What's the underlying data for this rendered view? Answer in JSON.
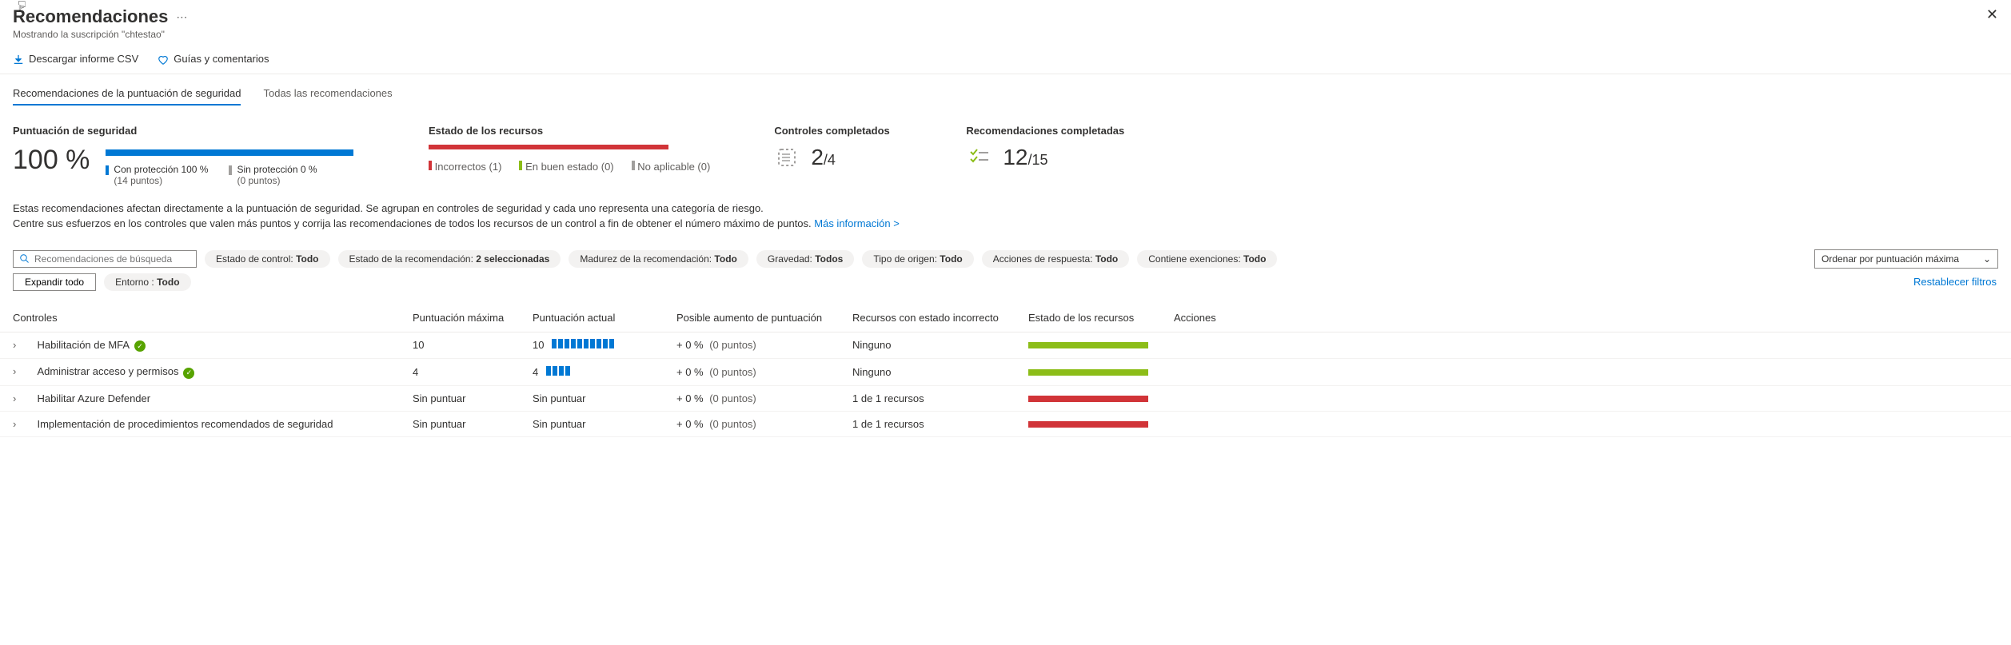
{
  "header": {
    "title": "Recomendaciones",
    "subtitle": "Mostrando la suscripción \"chtestao\""
  },
  "toolbar": {
    "download": "Descargar informe CSV",
    "guides": "Guías y comentarios"
  },
  "tabs": {
    "scored": "Recomendaciones de la puntuación de seguridad",
    "all": "Todas las recomendaciones"
  },
  "metrics": {
    "score": {
      "title": "Puntuación de seguridad",
      "value": "100 %",
      "protected_label": "Con protección 100 %",
      "protected_points": "(14 puntos)",
      "unprotected_label": "Sin protección 0 %",
      "unprotected_points": "(0 puntos)"
    },
    "resources": {
      "title": "Estado de los recursos",
      "bad": "Incorrectos (1)",
      "good": "En buen estado (0)",
      "na": "No aplicable (0)"
    },
    "controls": {
      "title": "Controles completados",
      "num": "2",
      "den": "/4"
    },
    "recs": {
      "title": "Recomendaciones completadas",
      "num": "12",
      "den": "/15"
    }
  },
  "description": {
    "line1": "Estas recomendaciones afectan directamente a la puntuación de seguridad. Se agrupan en controles de seguridad y cada uno representa una categoría de riesgo.",
    "line2": "Centre sus esfuerzos en los controles que valen más puntos y corrija las recomendaciones de todos los recursos de un control a fin de obtener el número máximo de puntos. ",
    "link": "Más información >"
  },
  "filters": {
    "search_placeholder": "Recomendaciones de búsqueda",
    "pills": [
      {
        "label": "Estado de control: ",
        "value": "Todo"
      },
      {
        "label": "Estado de la recomendación: ",
        "value": "2 seleccionadas"
      },
      {
        "label": "Madurez de la recomendación: ",
        "value": "Todo"
      },
      {
        "label": "Gravedad: ",
        "value": "Todos"
      },
      {
        "label": "Tipo de origen: ",
        "value": "Todo"
      },
      {
        "label": "Acciones de respuesta: ",
        "value": "Todo"
      },
      {
        "label": "Contiene exenciones: ",
        "value": "Todo"
      }
    ],
    "env_pill": {
      "label": "Entorno : ",
      "value": "Todo"
    },
    "expand": "Expandir todo",
    "sort": "Ordenar por puntuación máxima",
    "reset": "Restablecer filtros"
  },
  "table": {
    "headers": {
      "controls": "Controles",
      "max": "Puntuación máxima",
      "current": "Puntuación actual",
      "increase": "Posible aumento de puntuación",
      "unhealthy": "Recursos con estado incorrecto",
      "health": "Estado de los recursos",
      "actions": "Acciones"
    },
    "rows": [
      {
        "name": "Habilitación de MFA",
        "complete": true,
        "max": "10",
        "current": "10",
        "bars": 10,
        "increase_pct": "+ 0 %",
        "increase_pts": "(0 puntos)",
        "unhealthy": "Ninguno",
        "bar_color": "green"
      },
      {
        "name": "Administrar acceso y permisos",
        "complete": true,
        "max": "4",
        "current": "4",
        "bars": 4,
        "increase_pct": "+ 0 %",
        "increase_pts": "(0 puntos)",
        "unhealthy": "Ninguno",
        "bar_color": "green"
      },
      {
        "name": "Habilitar Azure Defender",
        "complete": false,
        "max": "Sin puntuar",
        "current": "Sin puntuar",
        "bars": 0,
        "increase_pct": "+ 0 %",
        "increase_pts": "(0 puntos)",
        "unhealthy": "1 de 1 recursos",
        "bar_color": "red"
      },
      {
        "name": "Implementación de procedimientos recomendados de seguridad",
        "complete": false,
        "max": "Sin puntuar",
        "current": "Sin puntuar",
        "bars": 0,
        "increase_pct": "+ 0 %",
        "increase_pts": "(0 puntos)",
        "unhealthy": "1 de 1 recursos",
        "bar_color": "red"
      }
    ]
  }
}
